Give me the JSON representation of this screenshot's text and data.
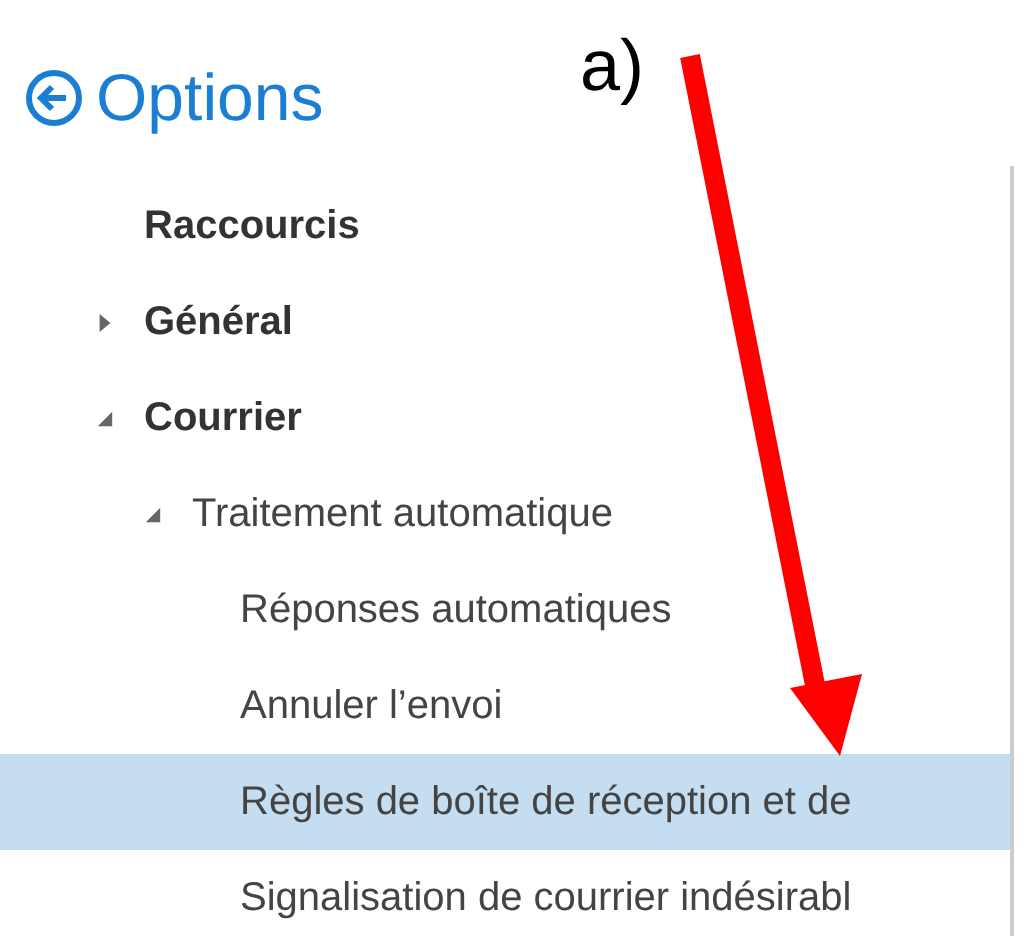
{
  "header": {
    "title": "Options"
  },
  "annotation": {
    "label": "a)"
  },
  "items": [
    {
      "label": "Raccourcis",
      "selected": false
    },
    {
      "label": "Général",
      "selected": false,
      "expanded": false
    },
    {
      "label": "Courrier",
      "selected": false,
      "expanded": true,
      "children": [
        {
          "label": "Traitement automatique",
          "selected": false,
          "expanded": true,
          "children": [
            {
              "label": "Réponses automatiques",
              "selected": false
            },
            {
              "label": "Annuler l’envoi",
              "selected": false
            },
            {
              "label": "Règles de boîte de réception et de",
              "selected": true
            },
            {
              "label": "Signalisation de courrier indésirabl",
              "selected": false
            }
          ]
        }
      ]
    }
  ]
}
